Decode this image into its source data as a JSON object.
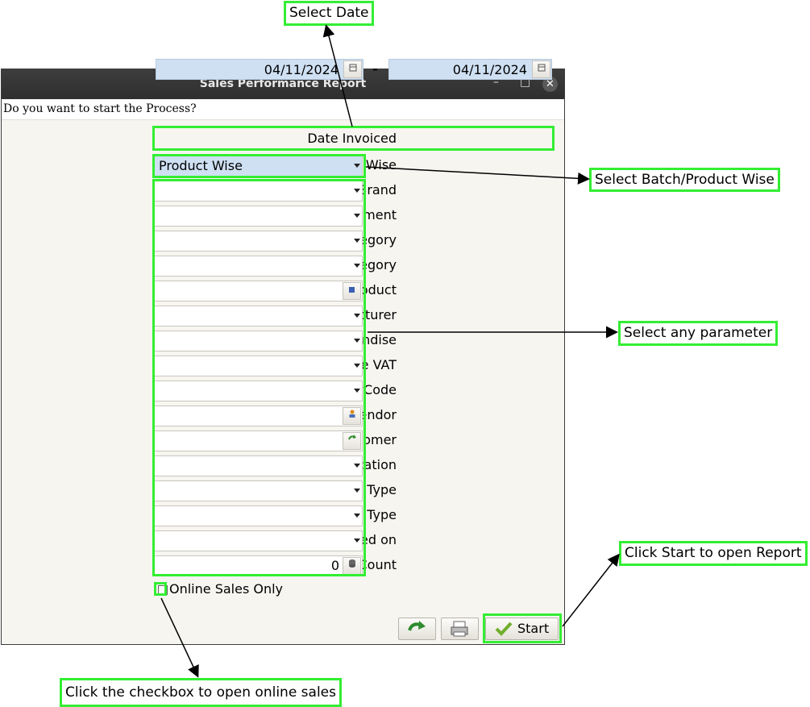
{
  "window": {
    "title": "Sales Performance Report",
    "minimize_glyph": "–",
    "maximize_glyph": "□",
    "close_glyph": "✕",
    "prompt": "Do you want to start the Process?"
  },
  "date": {
    "label": "Date Invoiced",
    "from": "04/11/2024",
    "separator": "-",
    "to": "04/11/2024"
  },
  "fields": [
    {
      "label": "Batch/Product Wise",
      "value": "Product Wise",
      "control": "dropdown"
    },
    {
      "label": "Brand",
      "value": "",
      "control": "dropdown"
    },
    {
      "label": "Department",
      "value": "",
      "control": "dropdown"
    },
    {
      "label": "Product Category",
      "value": "",
      "control": "dropdown"
    },
    {
      "label": "Sub Category",
      "value": "",
      "control": "dropdown"
    },
    {
      "label": "Product",
      "value": "",
      "control": "search",
      "icon": "product-search-icon"
    },
    {
      "label": "Manufacturer",
      "value": "",
      "control": "dropdown"
    },
    {
      "label": "Merchandise",
      "value": "",
      "control": "dropdown"
    },
    {
      "label": "Purchase VAT",
      "value": "",
      "control": "dropdown"
    },
    {
      "label": "CommodityCode",
      "value": "",
      "control": "dropdown"
    },
    {
      "label": "Vendor",
      "value": "",
      "control": "search",
      "icon": "vendor-icon"
    },
    {
      "label": "Customer",
      "value": "",
      "control": "search",
      "icon": "customer-icon"
    },
    {
      "label": "Classification",
      "value": "",
      "control": "dropdown"
    },
    {
      "label": "ITem Type",
      "value": "",
      "control": "dropdown"
    },
    {
      "label": "Product Moving Type",
      "value": "",
      "control": "dropdown"
    },
    {
      "label": "Moving Based on",
      "value": "",
      "control": "dropdown"
    },
    {
      "label": "Count",
      "value": "0",
      "control": "number",
      "icon": "calculator-icon"
    }
  ],
  "checkbox": {
    "label": "Online Sales Only",
    "checked": false
  },
  "buttons": {
    "start_label": "Start"
  },
  "callouts": {
    "select_date": "Select Date",
    "batch_product": "Select Batch/Product Wise",
    "any_parameter": "Select any parameter",
    "start": "Click Start to open Report",
    "online": "Click the checkbox to open online sales"
  },
  "colors": {
    "highlight": "#33ee33",
    "selected_field": "#cfe0f3",
    "titlebar": "#363636",
    "dialog_bg": "#f7f5f0"
  }
}
